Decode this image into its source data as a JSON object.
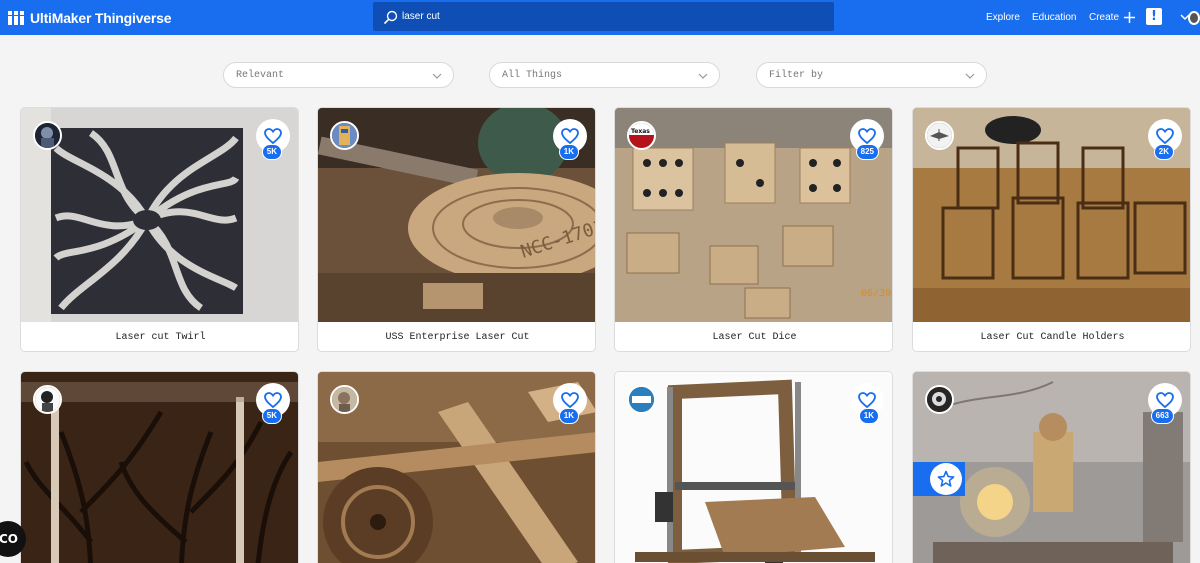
{
  "header": {
    "brand": "UltiMaker Thingiverse",
    "search_value": "laser cut",
    "nav": {
      "explore": "Explore",
      "education": "Education",
      "create": "Create"
    },
    "alert_symbol": "!"
  },
  "filters": [
    {
      "label": "Relevant"
    },
    {
      "label": "All Things"
    },
    {
      "label": "Filter by"
    }
  ],
  "cards": [
    {
      "title": "Laser cut Twirl",
      "likes": "5K"
    },
    {
      "title": "USS Enterprise Laser Cut",
      "likes": "1K"
    },
    {
      "title": "Laser Cut Dice",
      "likes": "825",
      "avatar_text": "Texas"
    },
    {
      "title": "Laser Cut Candle Holders",
      "likes": "2K"
    },
    {
      "title": "",
      "likes": "5K"
    },
    {
      "title": "",
      "likes": "1K"
    },
    {
      "title": "",
      "likes": "1K"
    },
    {
      "title": "",
      "likes": "663"
    }
  ],
  "dice_timestamp": "06/30",
  "chat_widget": "CO",
  "colors": {
    "brand": "#196ef0",
    "search_bg": "#0f4fb5"
  }
}
